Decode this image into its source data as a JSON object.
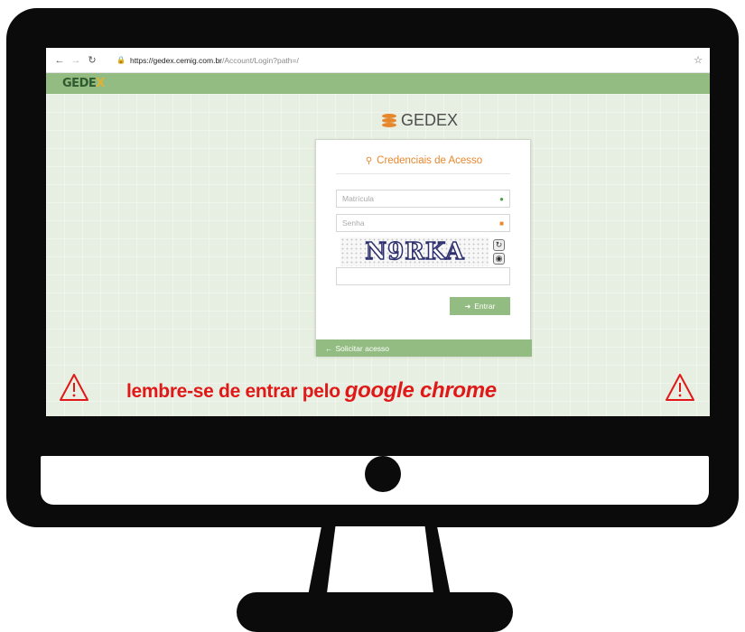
{
  "browser": {
    "back_icon": "arrow-left-icon",
    "forward_icon": "arrow-right-icon",
    "reload_icon": "reload-icon",
    "url_host": "https://gedex.cemig.com.br",
    "url_path": "/Account/Login?path=/",
    "bookmark_icon": "star-icon"
  },
  "header": {
    "logo_part1": "GE",
    "logo_part2": "DE",
    "logo_part3": "X"
  },
  "brand": {
    "title": "GEDEX",
    "icon": "database-icon"
  },
  "login": {
    "heading": "Credenciais de Acesso",
    "heading_icon": "key-icon",
    "username_placeholder": "Matrícula",
    "password_placeholder": "Senha",
    "captcha_text": "N9RKA",
    "submit_label": "Entrar",
    "request_access_label": "Solicitar acesso"
  },
  "warning": {
    "text": "lembre-se  de entrar pelo",
    "emphasis": "google chrome"
  },
  "colors": {
    "accent_green": "#93bc82",
    "accent_orange": "#e7872d",
    "warning_red": "#e01818"
  }
}
